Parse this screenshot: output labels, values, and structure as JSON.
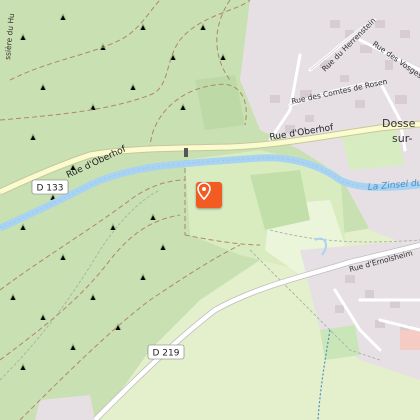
{
  "map": {
    "roads": {
      "rue_oberhof": "Rue d'Oberhof",
      "rue_ernolsheim": "Rue d'Ernolsheim",
      "rue_herrenstein": "Rue du Herrenstein",
      "rue_vosges": "Rue des Vosges",
      "rue_comtes": "Rue des Comtes de Rosen",
      "rue_left": "ssière du Hu"
    },
    "route_labels": {
      "d133": "D 133",
      "d219": "D 219"
    },
    "water_label": "La Zinsel du",
    "town_label_line1": "Dosse",
    "town_label_line2": "sur-",
    "marker": {
      "icon": "map-pin-icon",
      "color": "#f25c22"
    },
    "colors": {
      "forest": "#cde3b9",
      "meadow": "#e3f0cd",
      "river": "#a9d3f2",
      "urban": "#e8e1e6",
      "road": "#ffffff",
      "road_major": "#fbfbd0"
    }
  }
}
